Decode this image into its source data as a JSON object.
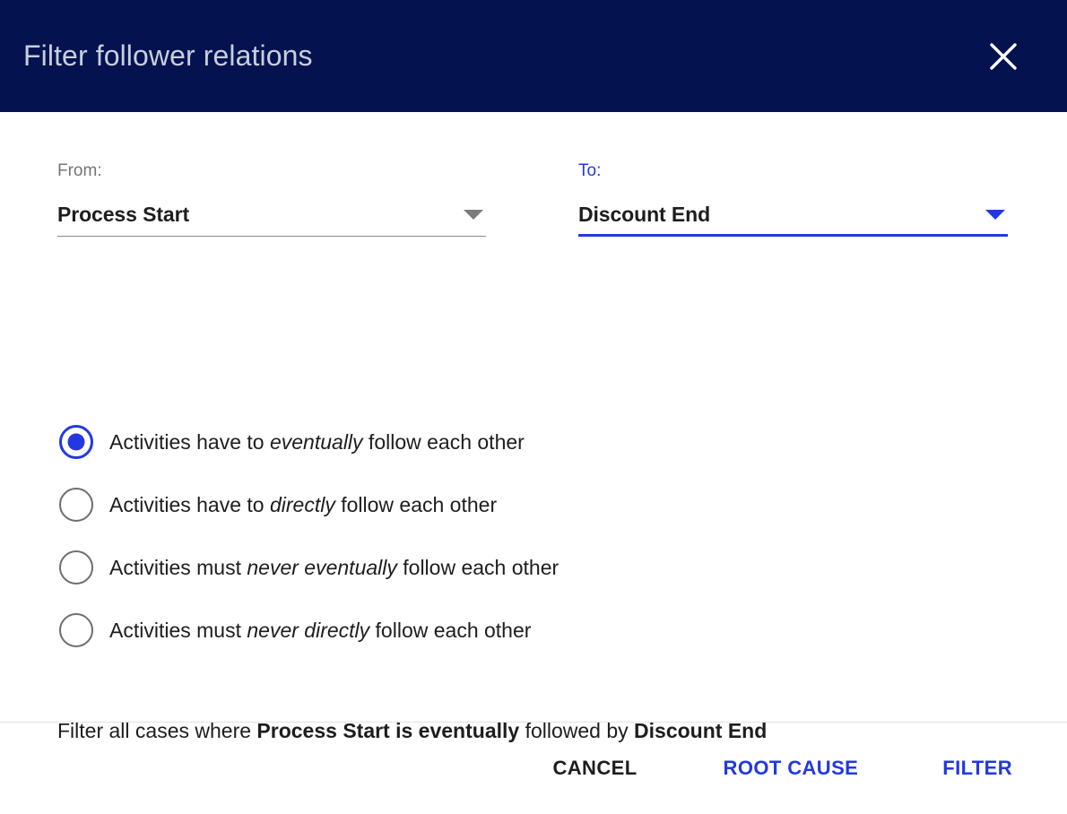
{
  "dialog": {
    "title": "Filter follower relations",
    "close_icon": "close-icon"
  },
  "theme": {
    "header_bg": "#04124f",
    "title_color": "#c7cede",
    "accent_blue": "#2338e0",
    "label_gray": "#757575",
    "text_dark": "#1d1d1d",
    "divider": "#e2e2e2"
  },
  "fields": {
    "from": {
      "label": "From:",
      "value": "Process Start",
      "caret_icon": "chevron-down-icon",
      "focused": false
    },
    "to": {
      "label": "To:",
      "value": "Discount End",
      "caret_icon": "chevron-down-icon",
      "focused": true
    }
  },
  "options": [
    {
      "selected": true,
      "pre": "Activities have to ",
      "emphasis": "eventually",
      "post": " follow each other"
    },
    {
      "selected": false,
      "pre": "Activities have to ",
      "emphasis": "directly",
      "post": " follow each other"
    },
    {
      "selected": false,
      "pre": "Activities must ",
      "emphasis": "never eventually",
      "post": " follow each other"
    },
    {
      "selected": false,
      "pre": "Activities must ",
      "emphasis": "never directly",
      "post": " follow each other"
    }
  ],
  "summary": {
    "prefix": "Filter all cases where ",
    "from_phrase": "Process Start is eventually",
    "middle": " followed by ",
    "to_phrase": "Discount End"
  },
  "footer": {
    "cancel_label": "CANCEL",
    "root_cause_label": "ROOT CAUSE",
    "filter_label": "FILTER"
  }
}
